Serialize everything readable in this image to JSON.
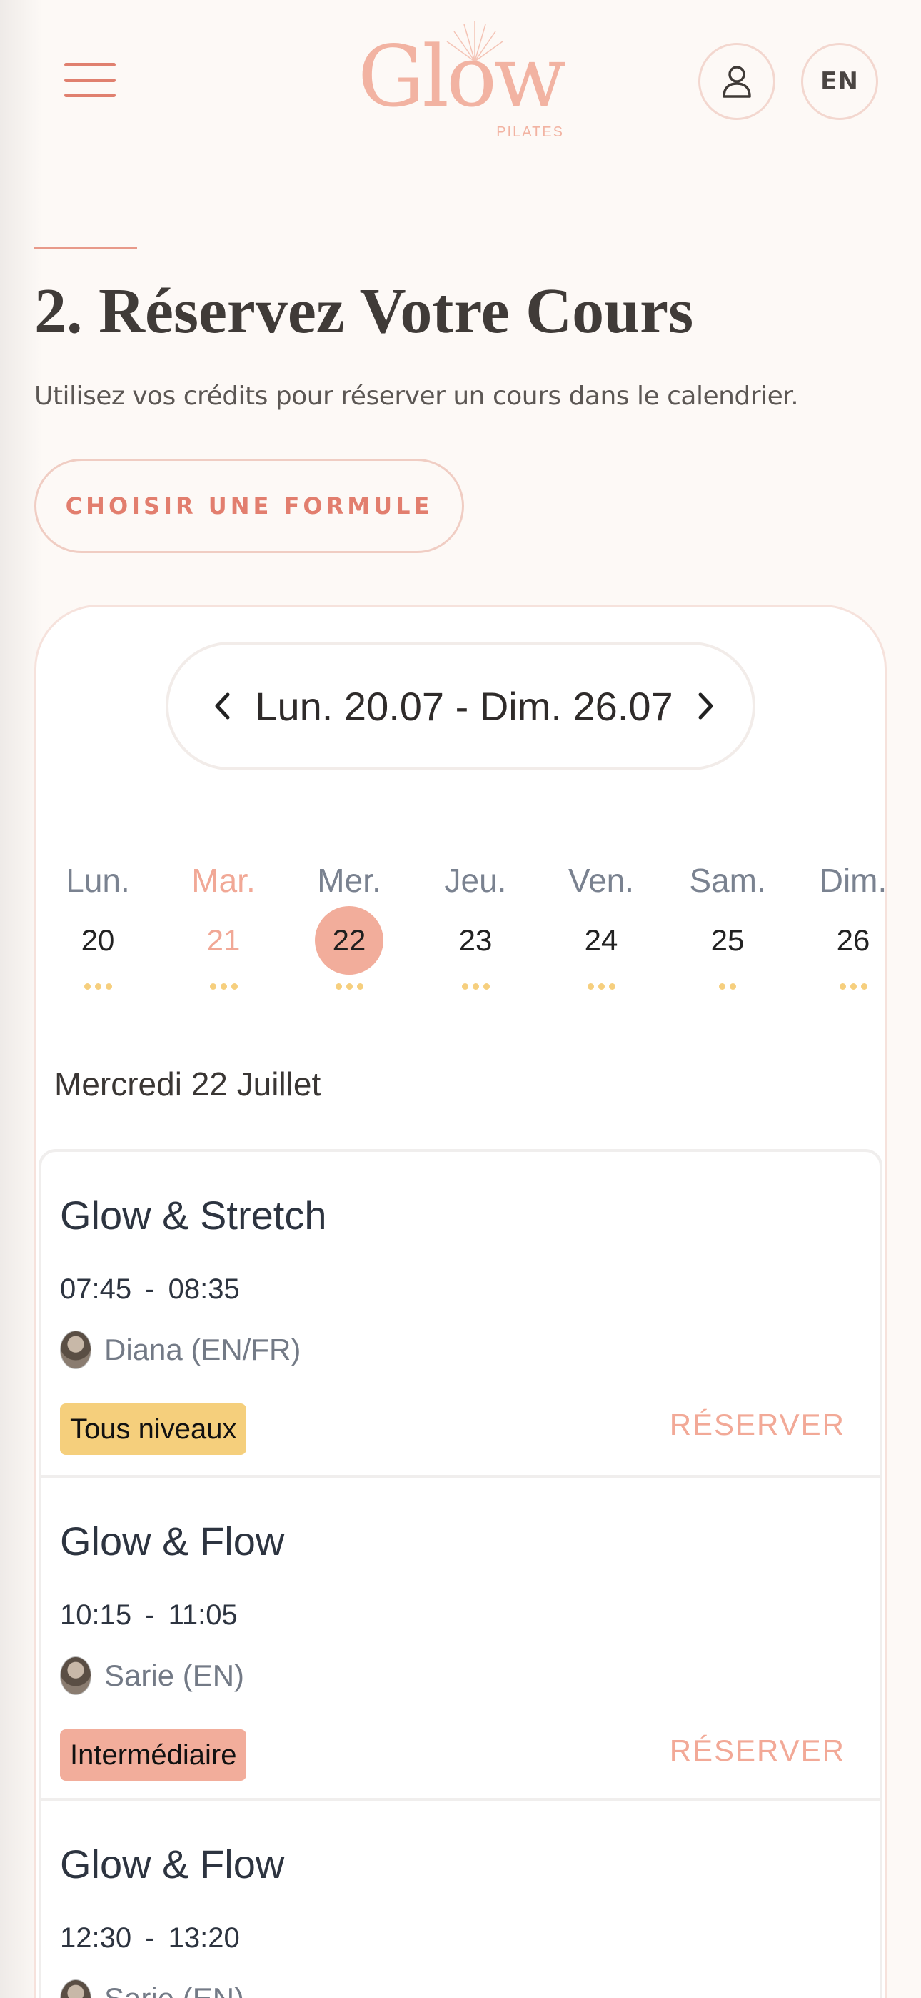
{
  "header": {
    "logo_text": "Glow",
    "logo_sub": "PILATES",
    "lang": "EN"
  },
  "section": {
    "title": "2. Réservez Votre Cours",
    "subtitle": "Utilisez vos crédits pour réserver un cours dans le calendrier.",
    "cta": "CHOISIR UNE FORMULE"
  },
  "calendar": {
    "week_label": "Lun. 20.07 - Dim. 26.07",
    "days": [
      {
        "name": "Lun.",
        "num": "20",
        "dots": 3
      },
      {
        "name": "Mar.",
        "num": "21",
        "dots": 3,
        "today": true
      },
      {
        "name": "Mer.",
        "num": "22",
        "dots": 3,
        "selected": true
      },
      {
        "name": "Jeu.",
        "num": "23",
        "dots": 3
      },
      {
        "name": "Ven.",
        "num": "24",
        "dots": 3
      },
      {
        "name": "Sam.",
        "num": "25",
        "dots": 2
      },
      {
        "name": "Dim.",
        "num": "26",
        "dots": 3
      }
    ],
    "selected_date": "Mercredi 22 Juillet"
  },
  "classes": [
    {
      "title": "Glow & Stretch",
      "start": "07:45",
      "end": "08:35",
      "teacher": "Diana (EN/FR)",
      "level": "Tous niveaux",
      "level_color": "#f5cf7c",
      "action": "RÉSERVER"
    },
    {
      "title": "Glow & Flow",
      "start": "10:15",
      "end": "11:05",
      "teacher": "Sarie (EN)",
      "level": "Intermédiaire",
      "level_color": "#f2ad9b",
      "action": "RÉSERVER"
    },
    {
      "title": "Glow & Flow",
      "start": "12:30",
      "end": "13:20",
      "teacher": "Sarie (EN)",
      "level": "",
      "level_color": "",
      "action": ""
    }
  ],
  "colors": {
    "accent": "#e27e6e",
    "accent_light": "#f2ad9b",
    "dot_yellow": "#f6cf7e",
    "background": "#fdf9f6"
  }
}
